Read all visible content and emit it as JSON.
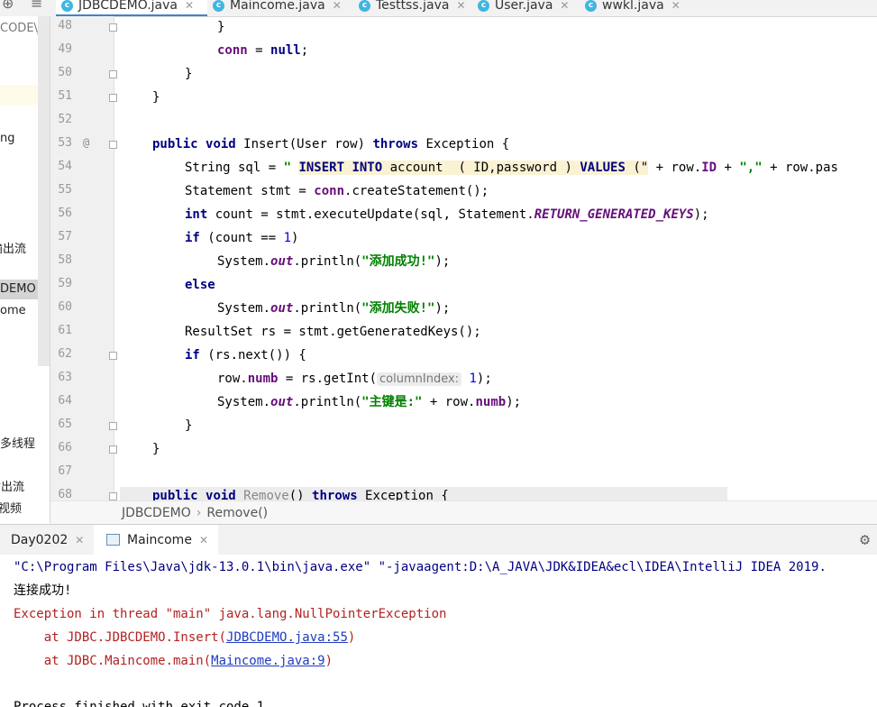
{
  "tabs": [
    {
      "label": "JDBCDEMO.java",
      "active": true
    },
    {
      "label": "Maincome.java",
      "active": false
    },
    {
      "label": "Testtss.java",
      "active": false
    },
    {
      "label": "User.java",
      "active": false
    },
    {
      "label": "wwkl.java",
      "active": false
    }
  ],
  "project_panel": {
    "items": [
      "CODE\\Jav",
      "ng",
      "输出流",
      "DEMO",
      "ome",
      "多线程",
      "输出流",
      "视频"
    ]
  },
  "editor": {
    "annotation": "@",
    "line_numbers": [
      "48",
      "49",
      "50",
      "51",
      "52",
      "53",
      "54",
      "55",
      "56",
      "57",
      "58",
      "59",
      "60",
      "61",
      "62",
      "63",
      "64",
      "65",
      "66",
      "67",
      "68"
    ],
    "lines": {
      "l48": [
        "}"
      ],
      "l49": [
        "conn",
        " = ",
        "null",
        ";"
      ],
      "l50": [
        "}"
      ],
      "l51": [
        "}"
      ],
      "l53": [
        "public",
        " ",
        "void",
        " Insert(User row) ",
        "throws",
        " Exception {"
      ],
      "l54": [
        "String sql = ",
        "\" ",
        "INSERT INTO",
        " account  ( ID,password ) ",
        "VALUES",
        " (\"",
        " + row.",
        "ID",
        " + ",
        "\",\"",
        " + row.pas"
      ],
      "l55": [
        "Statement stmt = ",
        "conn",
        ".createStatement();"
      ],
      "l56": [
        "int",
        " count = stmt.executeUpdate(sql, Statement.",
        "RETURN_GENERATED_KEYS",
        ");"
      ],
      "l57": [
        "if",
        " (count == ",
        "1",
        ")"
      ],
      "l58": [
        "System.",
        "out",
        ".println(",
        "\"添加成功!\"",
        ");"
      ],
      "l59": [
        "else"
      ],
      "l60": [
        "System.",
        "out",
        ".println(",
        "\"添加失败!\"",
        ");"
      ],
      "l61": [
        "ResultSet rs = stmt.getGeneratedKeys();"
      ],
      "l62": [
        "if",
        " (rs.next()) {"
      ],
      "l63": [
        "row.",
        "numb",
        " = rs.getInt(",
        "columnIndex:",
        " ",
        "1",
        ");"
      ],
      "l64": [
        "System.",
        "out",
        ".println(",
        "\"主键是:\"",
        " + row.",
        "numb",
        ");"
      ],
      "l65": [
        "}"
      ],
      "l66": [
        "}"
      ],
      "l68": [
        "public",
        " ",
        "void",
        " Remove",
        "() ",
        "throws",
        " Exception {"
      ]
    }
  },
  "breadcrumb": [
    "JDBCDEMO",
    "Remove()"
  ],
  "run_tabs": [
    {
      "label": "Day0202",
      "active": false
    },
    {
      "label": "Maincome",
      "active": true
    }
  ],
  "console": {
    "cmd": "\"C:\\Program Files\\Java\\jdk-13.0.1\\bin\\java.exe\" \"-javaagent:D:\\A_JAVA\\JDK&IDEA&ecl\\IDEA\\IntelliJ IDEA 2019.",
    "out1": "连接成功!",
    "err1": "Exception in thread \"main\" java.lang.NullPointerException",
    "err2_prefix": "    at JDBC.JDBCDEMO.Insert(",
    "err2_link": "JDBCDEMO.java:55",
    "err2_suffix": ")",
    "err3_prefix": "    at JDBC.Maincome.main(",
    "err3_link": "Maincome.java:9",
    "err3_suffix": ")",
    "finish": "Process finished with exit code 1"
  }
}
